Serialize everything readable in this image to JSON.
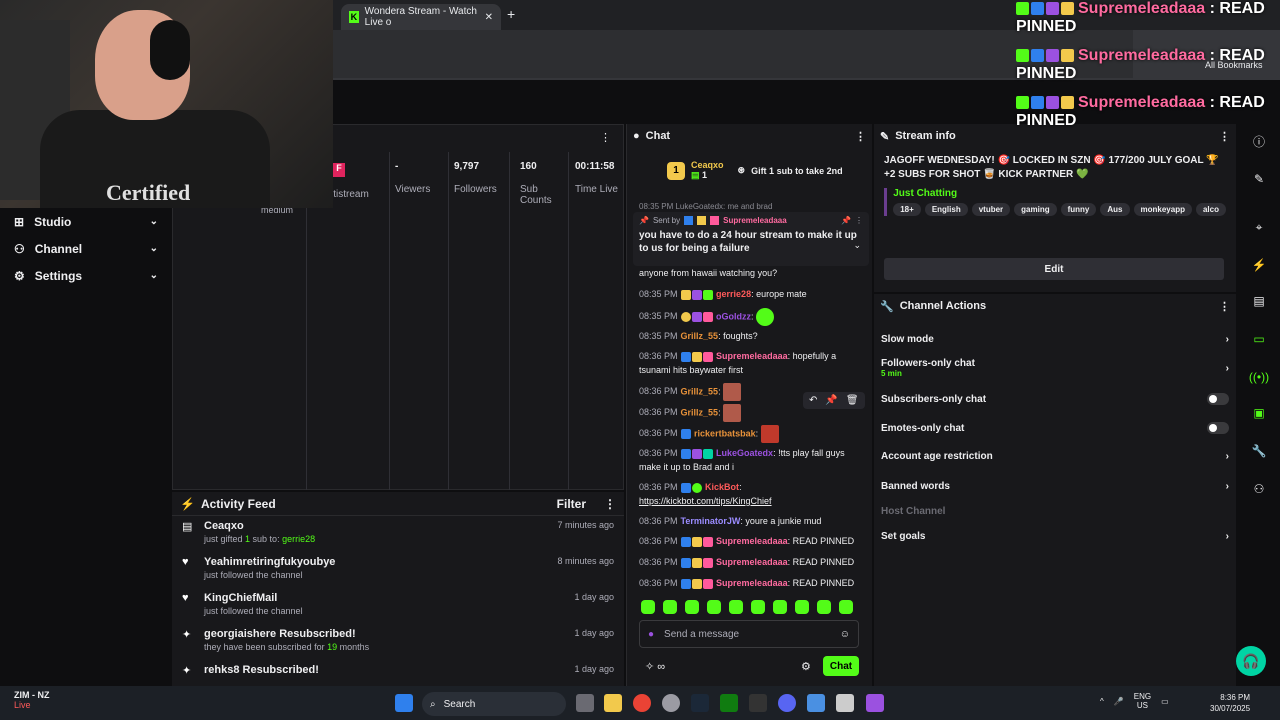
{
  "browser": {
    "tab_title": "Wondera Stream - Watch Live o",
    "tab_close": "✕",
    "new_tab": "+",
    "bookmarks_label": "All Bookmarks"
  },
  "webcam": {
    "shirt_text": "Certified"
  },
  "overlay_alerts": [
    {
      "username": "Supremeleadaaa",
      "text": " : READ",
      "line2": "PINNED"
    },
    {
      "username": "Supremeleadaaa",
      "text": " : READ",
      "line2": "PINNED"
    },
    {
      "username": "Supremeleadaaa",
      "text": " : READ",
      "line2": "PINNED"
    }
  ],
  "sidebar": {
    "items": [
      {
        "label": "Studio",
        "icon": "studio-icon"
      },
      {
        "label": "Channel",
        "icon": "channel-icon"
      },
      {
        "label": "Settings",
        "icon": "gear-icon"
      }
    ]
  },
  "stats": {
    "partial_labels": [
      "F",
      "ltistream",
      "medium"
    ],
    "items": [
      {
        "value": "-",
        "label": "Viewers"
      },
      {
        "value": "9,797",
        "label": "Followers"
      },
      {
        "value": "160",
        "label": "Sub Counts"
      },
      {
        "value": "00:11:58",
        "label": "Time Live"
      }
    ]
  },
  "activity": {
    "title": "Activity Feed",
    "filter_label": "Filter",
    "items": [
      {
        "name": "Ceaqxo",
        "detail_prefix": "just gifted ",
        "detail_num": "1",
        "detail_mid": " sub to: ",
        "detail_target": "gerrie28",
        "time": "7 minutes ago",
        "icon": "gift-icon"
      },
      {
        "name": "Yeahimretiringfukyoubye",
        "detail": "just followed the channel",
        "time": "8 minutes ago",
        "icon": "heart-icon"
      },
      {
        "name": "KingChiefMail",
        "detail": "just followed the channel",
        "time": "1 day ago",
        "icon": "heart-icon"
      },
      {
        "name": "georgiaishere Resubscribed!",
        "detail_prefix": "they have been subscribed for ",
        "detail_num": "19",
        "detail_mid": " months",
        "time": "1 day ago",
        "icon": "sparkle-icon"
      },
      {
        "name": "rehks8 Resubscribed!",
        "time": "1 day ago",
        "icon": "sparkle-icon"
      }
    ]
  },
  "chat": {
    "title": "Chat",
    "top_gifter": {
      "rank": "1",
      "name": "Ceaqxo",
      "count": "1"
    },
    "gift_label": "Gift 1 sub to take 2nd",
    "partial_line": "08:35 PM LukeGoatedx: me and brad",
    "pinned": {
      "sent_by_label": "Sent by",
      "username": "Supremeleadaaa",
      "message": "you have to do a 24 hour stream to make it up to us for being a failure"
    },
    "messages": [
      {
        "ts": "",
        "user": "",
        "color": "#efeff1",
        "text": "anyone from hawaii watching you?"
      },
      {
        "ts": "08:35 PM",
        "user": "gerrie28",
        "color": "#ff5a5a",
        "text": ": europe mate"
      },
      {
        "ts": "08:35 PM",
        "user": "oGoldzz",
        "color": "#9b51e0",
        "text": ":"
      },
      {
        "ts": "08:35 PM",
        "user": "Grillz_55",
        "color": "#e8923a",
        "text": ": foughts?"
      },
      {
        "ts": "08:36 PM",
        "user": "Supremeleadaaa",
        "color": "#ff6ba0",
        "text": ": hopefully a tsunami hits baywater first"
      },
      {
        "ts": "08:36 PM",
        "user": "Grillz_55",
        "color": "#e8923a",
        "text": ":"
      },
      {
        "ts": "08:36 PM",
        "user": "Grillz_55",
        "color": "#e8923a",
        "text": ":"
      },
      {
        "ts": "08:36 PM",
        "user": "rickertbatsbak",
        "color": "#e8923a",
        "text": ":"
      },
      {
        "ts": "08:36 PM",
        "user": "LukeGoatedx",
        "color": "#9b51e0",
        "text": ": !tts play fall guys make it up to Brad and i"
      },
      {
        "ts": "08:36 PM",
        "user": "KickBot",
        "color": "#ff5a5a",
        "text": ":",
        "link": "https://kickbot.com/tips/KingChief"
      },
      {
        "ts": "08:36 PM",
        "user": "TerminatorJW",
        "color": "#9b8cff",
        "text": ": youre a junkie mud"
      },
      {
        "ts": "08:36 PM",
        "user": "Supremeleadaaa",
        "color": "#ff6ba0",
        "text": ": READ PINNED"
      },
      {
        "ts": "08:36 PM",
        "user": "Supremeleadaaa",
        "color": "#ff6ba0",
        "text": ": READ PINNED"
      },
      {
        "ts": "08:36 PM",
        "user": "Supremeleadaaa",
        "color": "#ff6ba0",
        "text": ": READ PINNED"
      }
    ],
    "input_placeholder": "Send a message",
    "send_label": "Chat"
  },
  "stream_info": {
    "title": "Stream info",
    "stream_title": "JAGOFF WEDNESDAY! 🎯 LOCKED IN SZN 🎯 177/200 JULY GOAL 🏆 +2 SUBS FOR SHOT 🥃 KICK PARTNER 💚",
    "category": "Just Chatting",
    "tags": [
      "18+",
      "English",
      "vtuber",
      "gaming",
      "funny",
      "Aus",
      "monkeyapp",
      "alco"
    ],
    "edit_label": "Edit"
  },
  "channel_actions": {
    "title": "Channel Actions",
    "items": [
      {
        "label": "Slow mode",
        "control": "chevron"
      },
      {
        "label": "Followers-only chat",
        "sub": "5 min",
        "control": "chevron"
      },
      {
        "label": "Subscribers-only chat",
        "control": "toggle"
      },
      {
        "label": "Emotes-only chat",
        "control": "toggle"
      },
      {
        "label": "Account age restriction",
        "control": "chevron"
      },
      {
        "label": "Banned words",
        "control": "chevron"
      },
      {
        "label": "Host Channel",
        "control": "none",
        "disabled": true
      },
      {
        "label": "Set goals",
        "control": "chevron"
      }
    ]
  },
  "taskbar": {
    "live_app": "ZIM - NZ",
    "live_status": "Live",
    "search_label": "Search",
    "lang": "ENG",
    "region": "US",
    "time": "8:36 PM",
    "date": "30/07/2025"
  },
  "colors": {
    "accent": "#53fc18",
    "bg": "#0e0e10",
    "panel": "#18181b"
  }
}
